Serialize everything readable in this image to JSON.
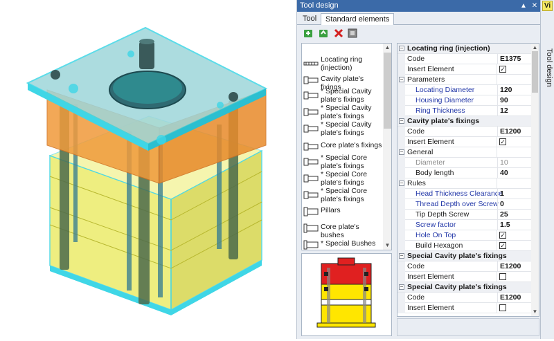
{
  "panel": {
    "title": "Tool design",
    "pin_icon": "pin-icon",
    "close_icon": "close-icon",
    "tabs": [
      {
        "label": "Tool",
        "active": false
      },
      {
        "label": "Standard elements",
        "active": true
      }
    ],
    "toolbar": [
      "add-green-icon",
      "refresh-green-icon",
      "delete-red-icon",
      "component-grey-icon"
    ]
  },
  "side": {
    "badge": "Vi",
    "label": "Tool design"
  },
  "elements": [
    {
      "label": "Locating ring (injection)",
      "icon": "ring-icon"
    },
    {
      "label": "Cavity plate's fixings",
      "icon": "screw-icon"
    },
    {
      "label": "* Special Cavity plate's fixings",
      "icon": "screw-icon"
    },
    {
      "label": "* Special Cavity plate's fixings",
      "icon": "screw-icon"
    },
    {
      "label": "* Special Cavity plate's fixings",
      "icon": "screw-icon"
    },
    {
      "label": "Core plate's fixings",
      "icon": "screw-icon"
    },
    {
      "label": "* Special Core plate's fixings",
      "icon": "screw-icon"
    },
    {
      "label": "* Special Core plate's fixings",
      "icon": "screw-icon"
    },
    {
      "label": "* Special Core plate's fixings",
      "icon": "screw-icon"
    },
    {
      "label": "Pillars",
      "icon": "pillar-icon"
    },
    {
      "label": "Core plate's bushes",
      "icon": "bush-icon"
    },
    {
      "label": "* Special Bushes",
      "icon": "bush-icon"
    }
  ],
  "properties": {
    "locating_ring": {
      "title": "Locating ring (injection)",
      "code_label": "Code",
      "code": "E1375",
      "insert_label": "Insert Element",
      "insert": true,
      "params_label": "Parameters",
      "diameter_label": "Locating Diameter",
      "diameter": "120",
      "housing_label": "Housing Diameter",
      "housing": "90",
      "thickness_label": "Ring Thickness",
      "thickness": "12"
    },
    "cavity_fixings": {
      "title": "Cavity plate's fixings",
      "code_label": "Code",
      "code": "E1200",
      "insert_label": "Insert Element",
      "insert": true,
      "general_label": "General",
      "diameter_label": "Diameter",
      "diameter": "10",
      "body_label": "Body length",
      "body": "40",
      "rules_label": "Rules",
      "head_label": "Head Thickness Clearance",
      "head": "1",
      "thread_label": "Thread Depth over Screw",
      "thread": "0",
      "tip_label": "Tip Depth Screw",
      "tip": "25",
      "factor_label": "Screw factor",
      "factor": "1.5",
      "hole_label": "Hole On Top",
      "hole": true,
      "hex_label": "Build Hexagon",
      "hex": true
    },
    "special_cavity_1": {
      "title": "Special Cavity plate's fixings",
      "code_label": "Code",
      "code": "E1200",
      "insert_label": "Insert Element",
      "insert": false
    },
    "special_cavity_2": {
      "title": "Special Cavity plate's fixings",
      "code_label": "Code",
      "code": "E1200",
      "insert_label": "Insert Element",
      "insert": false
    }
  },
  "colors": {
    "titlebar": "#3b6aa8",
    "plate_top": "#7fd4dc",
    "plate_orange": "#f0a040",
    "plate_yellow": "#e8e85a",
    "edge_cyan": "#3fd6e6",
    "preview_red": "#e02020",
    "preview_yellow": "#ffe600"
  }
}
